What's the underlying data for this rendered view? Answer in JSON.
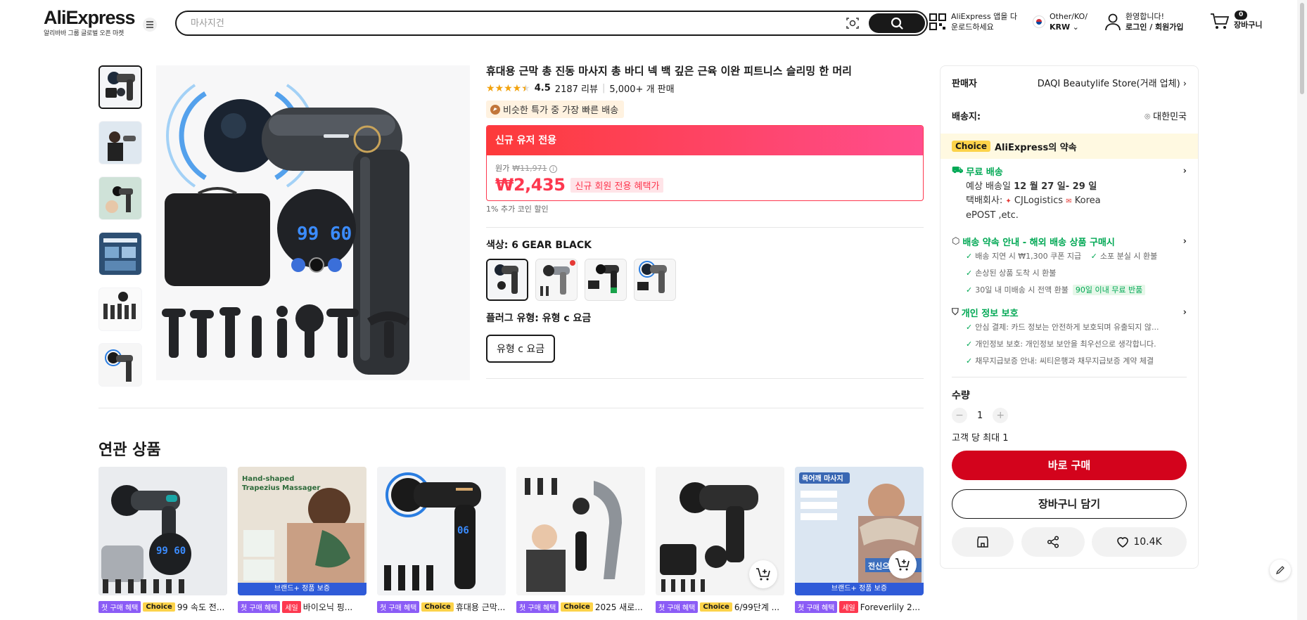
{
  "header": {
    "logo": "AliExpress",
    "logo_sub": "알리바바 그룹 글로벌 오픈 마켓",
    "search_placeholder": "마사지건",
    "app_line1": "AliExpress 앱을 다",
    "app_line2": "운로드하세요",
    "locale_line1": "Other/KO/",
    "locale_line2": "KRW",
    "account_line1": "환영합니다!",
    "account_line2": "로그인 / 회원가입",
    "cart_count": "0",
    "cart_label": "장바구니"
  },
  "product": {
    "title": "휴대용 근막 총 진동 마사지 총 바디 넥 백 깊은 근육 이완 피트니스 슬리밍 한 머리",
    "rating": 4.5,
    "rating_text": "4.5",
    "reviews": "2187 리뷰",
    "sold": "5,000+ 개 판매",
    "fast_badge": "비슷한 특가 중 가장 빠른 배송",
    "promo_header": "신규 유저 전용",
    "original_label": "원가",
    "original_price": "₩11,971",
    "price": "₩2,435",
    "price_tag": "신규 회원 전용 혜택가",
    "coin": "1% 추가 코인 할인",
    "color_label": "색상: 6 GEAR BLACK",
    "plug_label": "플러그 유형: 유형 c 요금",
    "plug_option": "유형 c 요금"
  },
  "panel": {
    "seller_label": "판매자",
    "seller_value": "DAQI Beautylife Store(거래 업체)",
    "ship_to_label": "배송지:",
    "ship_to_value": "대한민국",
    "choice_tag": "Choice",
    "choice_text": "AliExpress의 약속",
    "free_ship": "무료 배송",
    "eta_label": "예상 배송일",
    "eta_value": "12 월 27 일- 29 일",
    "carrier_label": "택배회사:",
    "carrier_a": "CJLogistics",
    "carrier_b": "Korea",
    "carrier_c": "ePOST ,etc.",
    "promise_title": "배송 약속 안내 - 해외 배송 상품 구매시",
    "promise_1": "배송 지연 시 ₩1,300 쿠폰 지급",
    "promise_2": "소포 분실 시 환불",
    "promise_3": "손상된 상품 도착 시 환불",
    "promise_4": "30일 내 미배송 시 전액 환불",
    "promise_tag": "90일 이내 무료 반품",
    "privacy_title": "개인 정보 보호",
    "privacy_1": "안심 결제: 카드 정보는 안전하게 보호되며 유출되지 않...",
    "privacy_2": "개인정보 보호: 개인정보 보안을 최우선으로 생각합니다.",
    "privacy_3": "채무지급보증 안내: 씨티은행과 채무지급보증 계약 체결",
    "qty_label": "수량",
    "qty_value": "1",
    "limit": "고객 당 최대 1",
    "buy_now": "바로 구매",
    "add_cart": "장바구니 담기",
    "wishlist_count": "10.4K"
  },
  "related": {
    "title": "연관 상품",
    "first_tag": "첫 구매 혜택",
    "choice_tag": "Choice",
    "sale_tag": "세일",
    "brand_bar": "브랜드+ 정품 보증",
    "items": [
      {
        "name": "99 속도 전..."
      },
      {
        "name": "바이오닉 핑..."
      },
      {
        "name": "휴대용 근막..."
      },
      {
        "name": "2025 새로..."
      },
      {
        "name": "6/99단계 ..."
      },
      {
        "name": "Foreverlily 2..."
      }
    ],
    "card2_text1": "Hand-shaped",
    "card2_text2": "Trapezius Massager",
    "card6_text1": "목어깨 마사지",
    "card6_text2": "전신으로 사용"
  },
  "colors": {
    "accent_red": "#fd384f",
    "buy_red": "#d3031c",
    "green": "#00a854",
    "choice_yellow": "#fcd34a"
  }
}
